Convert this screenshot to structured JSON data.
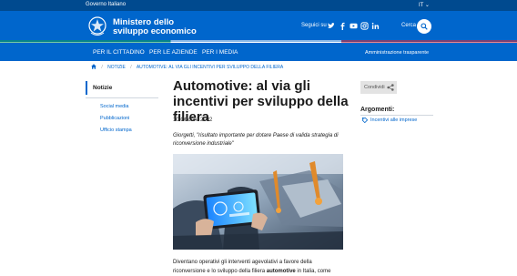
{
  "topbar": {
    "government": "Governo Italiano",
    "language": "IT"
  },
  "header": {
    "ministry_line1": "Ministero dello",
    "ministry_line2": "sviluppo economico",
    "follow_label": "Seguici su",
    "social_icons": [
      "twitter-icon",
      "facebook-icon",
      "youtube-icon",
      "instagram-icon",
      "linkedin-icon"
    ],
    "search_label": "Cerca"
  },
  "nav": {
    "items": [
      "PER IL CITTADINO",
      "PER LE AZIENDE",
      "PER I MEDIA"
    ],
    "transparency": "Amministrazione trasparente"
  },
  "breadcrumb": {
    "items": [
      "NOTIZIE",
      "AUTOMOTIVE: AL VIA GLI INCENTIVI PER SVILUPPO DELLA FILIERA"
    ]
  },
  "sidebar": {
    "active": "Notizie",
    "items": [
      "Social media",
      "Pubblicazioni",
      "Ufficio stampa"
    ]
  },
  "article": {
    "title": "Automotive: al via gli incentivi per sviluppo della filiera",
    "date": "10 Ottobre 2022",
    "subtitle": "Giorgetti, \"risultato importante per dotare Paese di valida strategia di riconversione industriale\"",
    "body_start": "Diventano operativi gli interventi agevolativi a favore della riconversione e lo sviluppo della filiera ",
    "body_bold": "automotive",
    "body_end": " in Italia, come"
  },
  "share": {
    "label": "Condividi"
  },
  "arguments": {
    "title": "Argomenti:",
    "link": "Incentivi alle imprese"
  },
  "colors": {
    "primary": "#0066cc",
    "topbar": "#004a8f"
  }
}
